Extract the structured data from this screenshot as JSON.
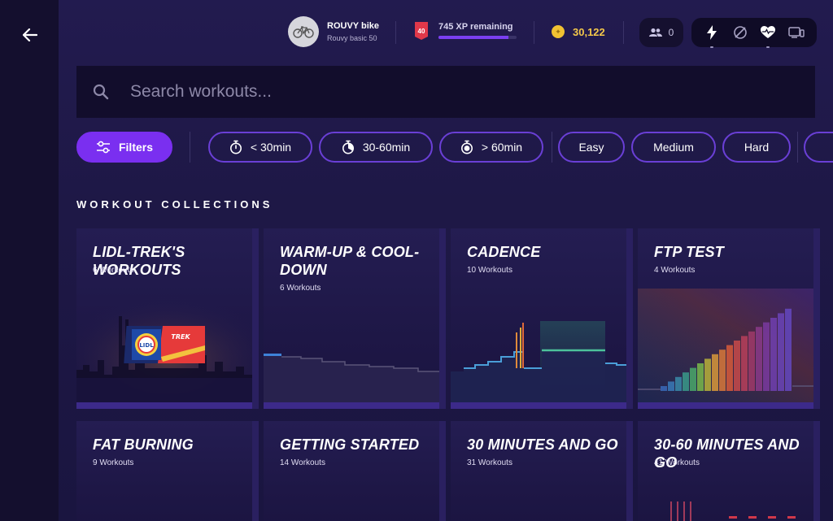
{
  "colors": {
    "accent": "#7a2ff0",
    "coin": "#f4c84a",
    "level_badge": "#e0384a"
  },
  "nav": {
    "back_icon": "arrow-left-icon"
  },
  "profile": {
    "name": "ROUVY bike",
    "subtitle": "Rouvy basic 50"
  },
  "level": {
    "value": "40",
    "xp_remaining": "745 XP remaining",
    "xp_progress_percent": 90
  },
  "coins": {
    "value": "30,122"
  },
  "friends": {
    "count": "0"
  },
  "sensors": [
    "power-icon",
    "cadence-icon",
    "heart-rate-icon",
    "trainer-icon"
  ],
  "search": {
    "placeholder": "Search workouts..."
  },
  "filters": {
    "primary": "Filters",
    "durations": [
      "< 30min",
      "30-60min",
      "> 60min"
    ],
    "difficulties": [
      "Easy",
      "Medium",
      "Hard"
    ]
  },
  "section": {
    "title": "WORKOUT COLLECTIONS"
  },
  "collections": [
    {
      "title": "LIDL-TREK'S WORKOUTS",
      "count": "6 Workouts"
    },
    {
      "title": "WARM-UP & COOL-DOWN",
      "count": "6 Workouts"
    },
    {
      "title": "CADENCE",
      "count": "10 Workouts"
    },
    {
      "title": "FTP TEST",
      "count": "4 Workouts"
    },
    {
      "title": "FAT BURNING",
      "count": "9 Workouts"
    },
    {
      "title": "GETTING STARTED",
      "count": "14 Workouts"
    },
    {
      "title": "30 MINUTES AND GO",
      "count": "31 Workouts"
    },
    {
      "title": "30-60 MINUTES AND GO",
      "count": "41 Workouts"
    }
  ],
  "logos": {
    "lidl": "LIDL",
    "trek": "TREK"
  }
}
